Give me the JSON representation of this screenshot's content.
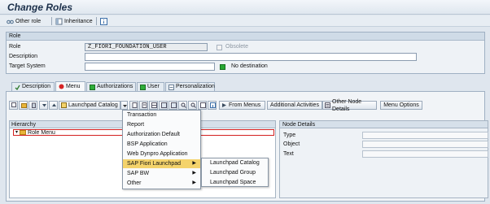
{
  "window": {
    "title": "Change Roles"
  },
  "appbar": {
    "other_role": "Other role",
    "inheritance": "Inheritance"
  },
  "role_section": {
    "header": "Role",
    "role_label": "Role",
    "role_value": "Z_FIORI_FOUNDATION_USER",
    "obsolete_label": "Obsolete",
    "description_label": "Description",
    "description_value": "",
    "target_system_label": "Target System",
    "target_system_value": "",
    "destination_status": "No destination"
  },
  "tabs": [
    {
      "label": "Description",
      "icon": "check-icon",
      "active": false
    },
    {
      "label": "Menu",
      "icon": "red-circle-icon",
      "active": true
    },
    {
      "label": "Authorizations",
      "icon": "green-square-icon",
      "active": false
    },
    {
      "label": "User",
      "icon": "green-square-icon",
      "active": false
    },
    {
      "label": "Personalization",
      "icon": "personalization-icon",
      "active": false
    }
  ],
  "toolbar": {
    "launchpad_catalog": "Launchpad Catalog",
    "from_menus": "From Menus",
    "additional_activities": "Additional Activities",
    "other_node_details": "Other Node Details",
    "menu_options": "Menu Options"
  },
  "hierarchy": {
    "header": "Hierarchy",
    "root": "Role Menu"
  },
  "node_details": {
    "header": "Node Details",
    "type_label": "Type",
    "object_label": "Object",
    "text_label": "Text"
  },
  "context_menu": {
    "items": [
      {
        "label": "Transaction"
      },
      {
        "label": "Report"
      },
      {
        "label": "Authorization Default"
      },
      {
        "label": "BSP Application"
      },
      {
        "label": "Web Dynpro Application"
      },
      {
        "label": "SAP Fiori Launchpad",
        "submenu": true,
        "highlighted": true
      },
      {
        "label": "SAP BW",
        "submenu": true
      },
      {
        "label": "Other",
        "submenu": true
      }
    ]
  },
  "submenu": {
    "items": [
      {
        "label": "Launchpad Catalog"
      },
      {
        "label": "Launchpad Group"
      },
      {
        "label": "Launchpad Space"
      }
    ]
  }
}
